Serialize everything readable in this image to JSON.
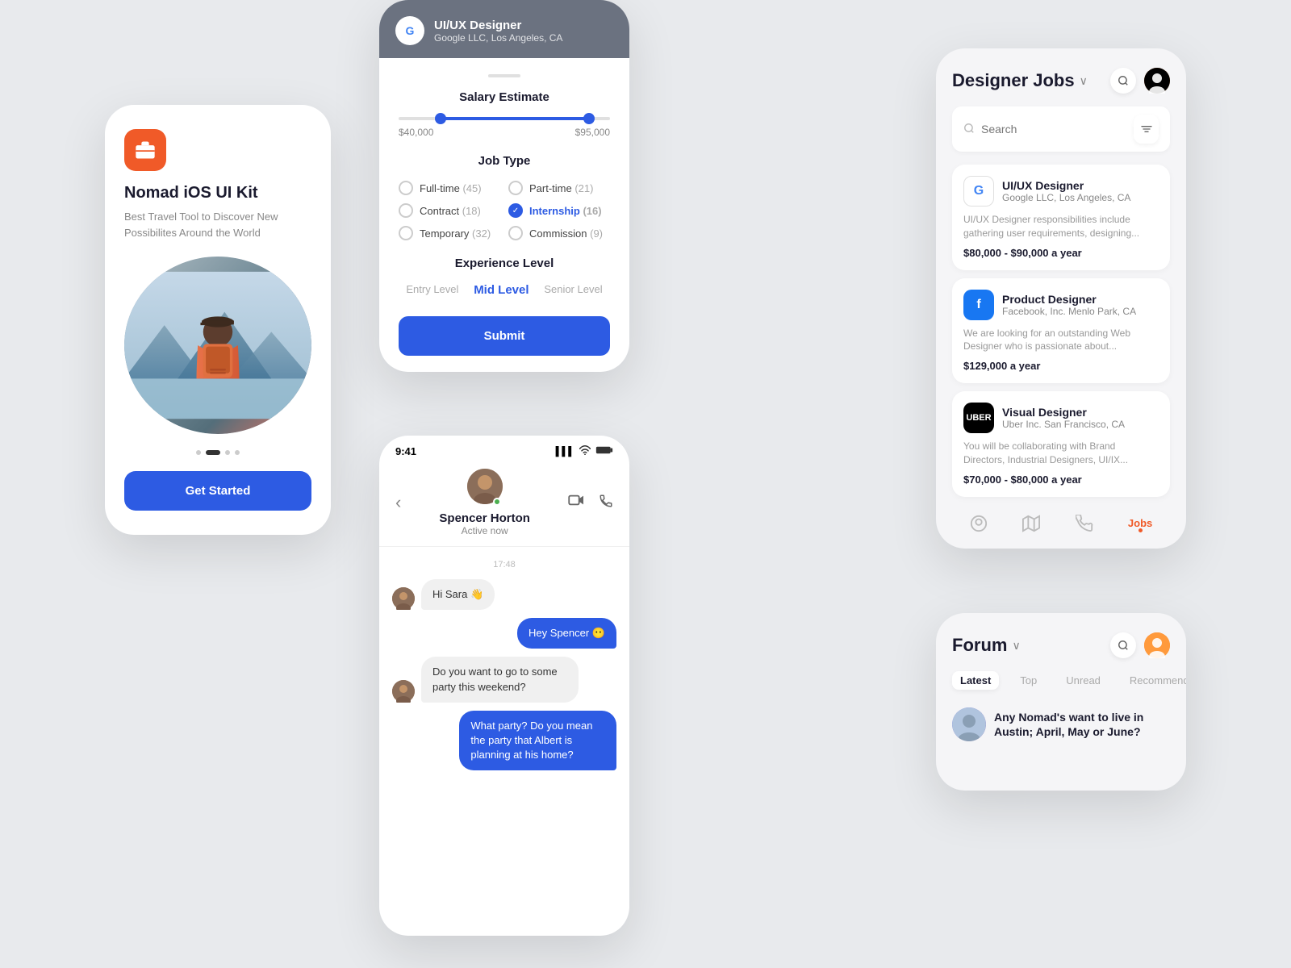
{
  "phone1": {
    "app_icon_label": "briefcase",
    "title": "Nomad iOS UI Kit",
    "description": "Best Travel Tool to Discover New Possibilites Around the World",
    "cta_label": "Get Started"
  },
  "phone2": {
    "header": {
      "job_title": "UI/UX Designer",
      "company": "Google LLC, Los Angeles, CA"
    },
    "salary": {
      "section_title": "Salary Estimate",
      "min": "$40,000",
      "max": "$95,000"
    },
    "job_type": {
      "section_title": "Job Type",
      "options": [
        {
          "label": "Full-time",
          "count": "(45)",
          "checked": false
        },
        {
          "label": "Part-time",
          "count": "(21)",
          "checked": false
        },
        {
          "label": "Contract",
          "count": "(18)",
          "checked": false
        },
        {
          "label": "Internship",
          "count": "(16)",
          "checked": true
        },
        {
          "label": "Temporary",
          "count": "(32)",
          "checked": false
        },
        {
          "label": "Commission",
          "count": "(9)",
          "checked": false
        }
      ]
    },
    "experience": {
      "section_title": "Experience Level",
      "levels": [
        "Entry Level",
        "Mid Level",
        "Senior Level"
      ],
      "active": "Mid Level"
    },
    "submit_label": "Submit"
  },
  "phone3": {
    "status_bar": {
      "time": "9:41",
      "signal": "▌▌▌",
      "wifi": "wifi",
      "battery": "battery"
    },
    "contact": {
      "name": "Spencer Horton",
      "status": "Active now"
    },
    "timestamp": "17:48",
    "messages": [
      {
        "type": "received",
        "text": "Hi Sara 👋",
        "has_avatar": true
      },
      {
        "type": "sent",
        "text": "Hey Spencer 😶"
      },
      {
        "type": "received",
        "text": "Do you want to go to some party this weekend?",
        "has_avatar": true
      },
      {
        "type": "sent",
        "text": "What party? Do you mean the party that Albert is planning at his home?"
      }
    ]
  },
  "phone4": {
    "title": "Designer Jobs",
    "search_placeholder": "Search",
    "jobs": [
      {
        "logo_type": "google",
        "logo_text": "G",
        "title": "UI/UX Designer",
        "company": "Google LLC, Los Angeles, CA",
        "description": "UI/UX Designer responsibilities include gathering user requirements, designing...",
        "salary": "$80,000 - $90,000 a year"
      },
      {
        "logo_type": "facebook",
        "logo_text": "f",
        "title": "Product Designer",
        "company": "Facebook, Inc. Menlo Park, CA",
        "description": "We are looking for an outstanding Web Designer who is passionate about...",
        "salary": "$129,000 a year"
      },
      {
        "logo_type": "uber",
        "logo_text": "UBER",
        "title": "Visual Designer",
        "company": "Uber Inc. San Francisco, CA",
        "description": "You will be collaborating with Brand Directors, Industrial Designers, UI/IX...",
        "salary": "$70,000 - $80,000 a year"
      }
    ],
    "nav": [
      {
        "icon": "☺",
        "label": "home",
        "active": false
      },
      {
        "icon": "🗺",
        "label": "map",
        "active": false
      },
      {
        "icon": "✈",
        "label": "travel",
        "active": false
      },
      {
        "icon": "Jobs",
        "label": "jobs",
        "active": true
      }
    ]
  },
  "phone5": {
    "title": "Forum",
    "tabs": [
      "Latest",
      "Top",
      "Unread",
      "Recommended"
    ],
    "active_tab": "Latest",
    "post_title": "Any Nomad's want to live in Austin; April, May or June?"
  }
}
